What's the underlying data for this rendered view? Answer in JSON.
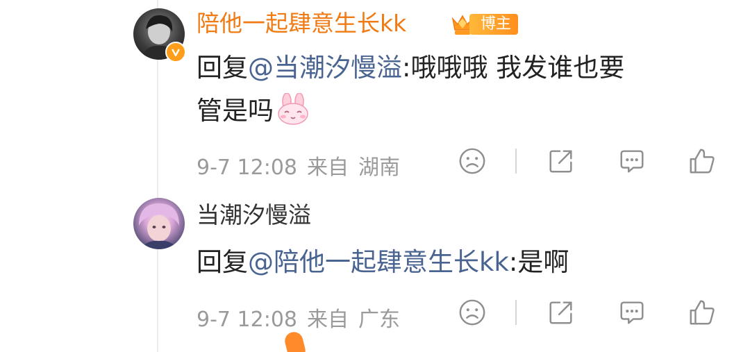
{
  "comments": [
    {
      "username": "陪他一起肆意生长kk",
      "badge_label": "博主",
      "reply_prefix": "回复",
      "mention": "@当潮汐慢溢",
      "separator": ":",
      "text_line1": "哦哦哦 我发谁也要",
      "text_line2": "管是吗",
      "emoji": "bunny-emoji",
      "date": "9-7 12:08",
      "source_label": "来自",
      "location": "湖南"
    },
    {
      "username": "当潮汐慢溢",
      "reply_prefix": "回复",
      "mention": "@陪他一起肆意生长kk",
      "separator": ":",
      "text": "是啊",
      "date": "9-7 12:08",
      "source_label": "来自",
      "location": "广东"
    }
  ],
  "icons": {
    "dislike": "sad-face-icon",
    "share": "share-icon",
    "comment": "comment-icon",
    "like": "thumbs-up-icon",
    "verified": "verified-v-icon",
    "crown": "crown-icon"
  },
  "colors": {
    "blogger_name": "#f07b14",
    "mention": "#4a6491",
    "meta": "#9a9a9a",
    "badge": "#ff9e1b"
  }
}
